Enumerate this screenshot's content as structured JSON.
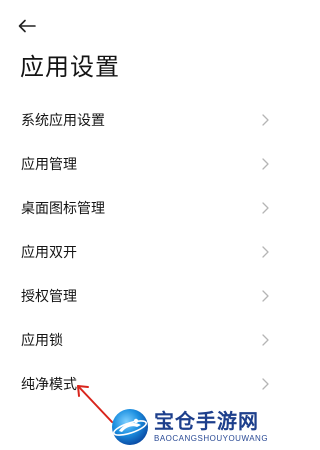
{
  "header": {
    "title": "应用设置",
    "back_icon": "arrow-left-icon"
  },
  "settings": {
    "items": [
      {
        "label": "系统应用设置"
      },
      {
        "label": "应用管理"
      },
      {
        "label": "桌面图标管理"
      },
      {
        "label": "应用双开"
      },
      {
        "label": "授权管理"
      },
      {
        "label": "应用锁"
      },
      {
        "label": "纯净模式"
      }
    ],
    "chevron_icon": "chevron-right-icon"
  },
  "annotation": {
    "arrow_color": "#d9251c"
  },
  "watermark": {
    "name": "宝仓手游网",
    "domain": "BAOCANGSHOUYOUWANG"
  }
}
